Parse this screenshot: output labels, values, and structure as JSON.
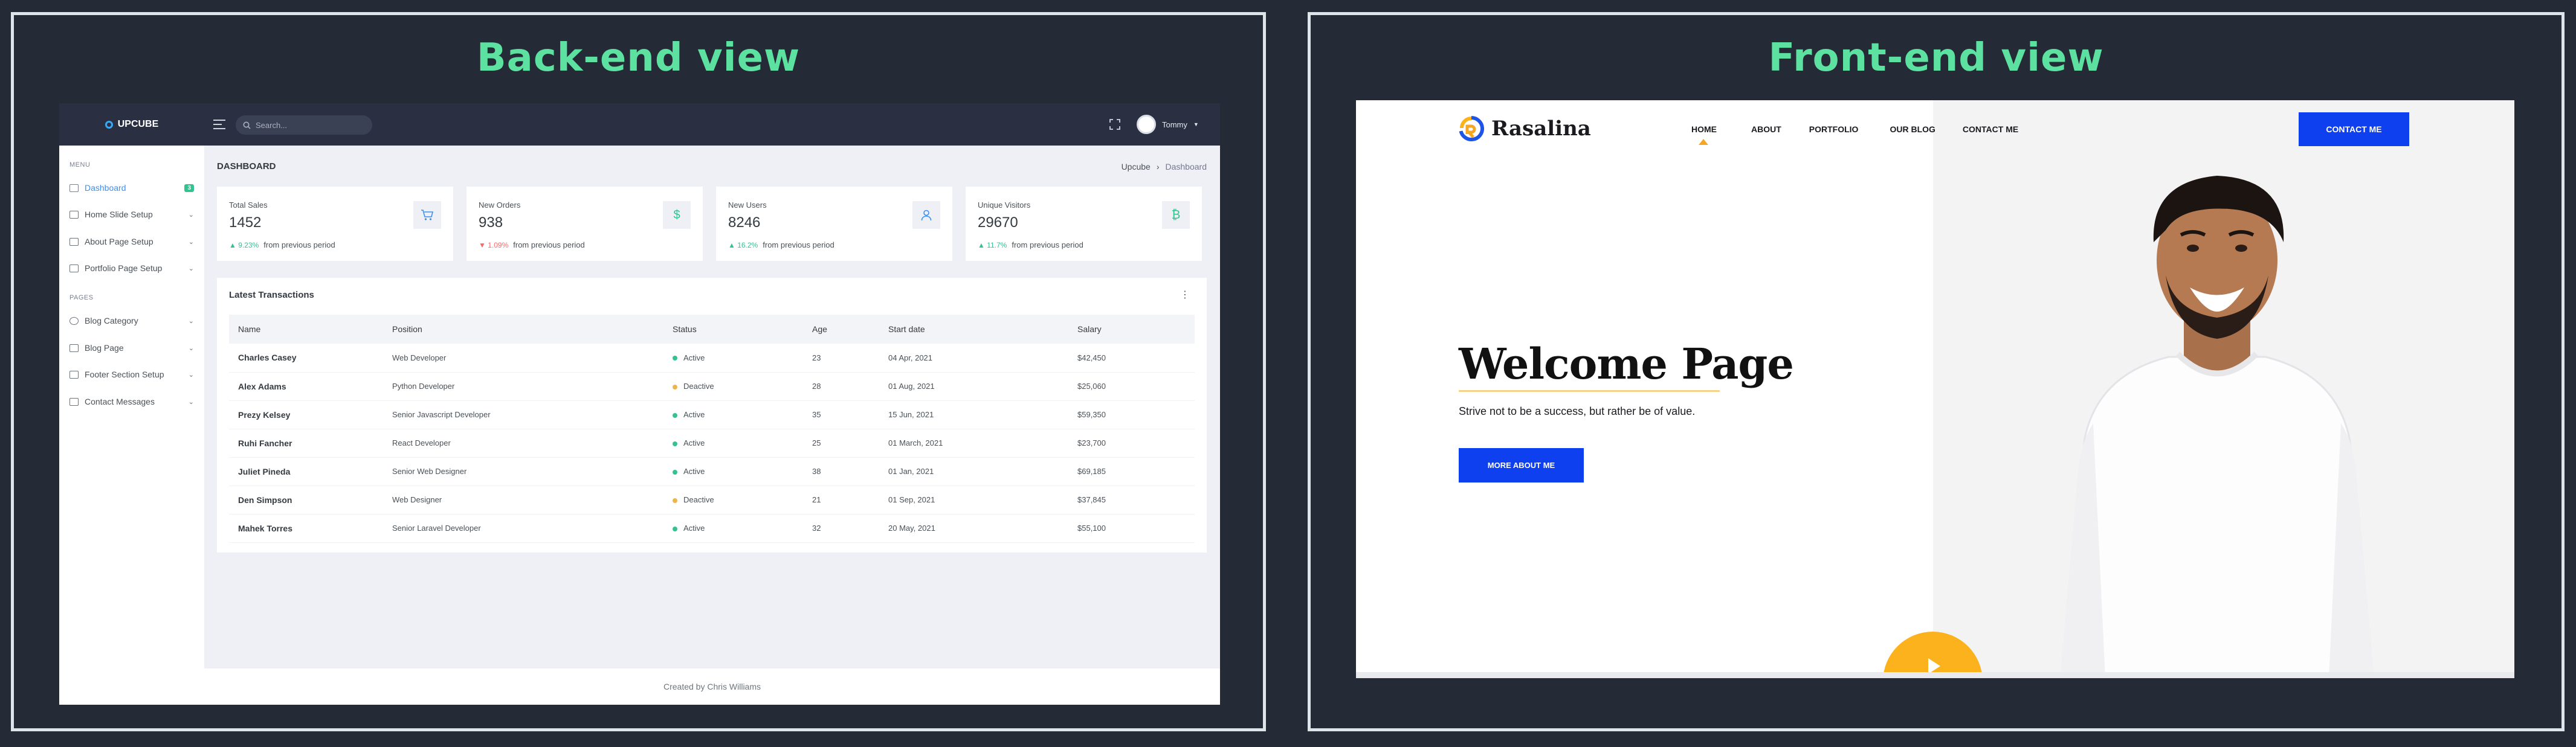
{
  "panels": {
    "back_title": "Back-end view",
    "front_title": "Front-end view"
  },
  "admin": {
    "brand": "UPCUBE",
    "search_placeholder": "Search...",
    "user_name": "Tommy",
    "sidebar": {
      "menu_heading": "MENU",
      "pages_heading": "PAGES",
      "dashboard_label": "Dashboard",
      "dashboard_badge": "3",
      "items": [
        {
          "label": "Home Slide Setup"
        },
        {
          "label": "About Page Setup"
        },
        {
          "label": "Portfolio Page Setup"
        },
        {
          "label": "Blog Category"
        },
        {
          "label": "Blog Page"
        },
        {
          "label": "Footer Section Setup"
        },
        {
          "label": "Contact Messages"
        }
      ]
    },
    "page_title": "DASHBOARD",
    "breadcrumb": {
      "root": "Upcube",
      "current": "Dashboard"
    },
    "stats": [
      {
        "label": "Total Sales",
        "value": "1452",
        "pct": "9.23%",
        "trend": "up",
        "suffix": "from previous period",
        "icon": "cart-icon"
      },
      {
        "label": "New Orders",
        "value": "938",
        "pct": "1.09%",
        "trend": "down",
        "suffix": "from previous period",
        "icon": "dollar-icon"
      },
      {
        "label": "New Users",
        "value": "8246",
        "pct": "16.2%",
        "trend": "up",
        "suffix": "from previous period",
        "icon": "user-icon"
      },
      {
        "label": "Unique Visitors",
        "value": "29670",
        "pct": "11.7%",
        "trend": "up",
        "suffix": "from previous period",
        "icon": "bitcoin-icon"
      }
    ],
    "transactions": {
      "title": "Latest Transactions",
      "columns": [
        "Name",
        "Position",
        "Status",
        "Age",
        "Start date",
        "Salary"
      ],
      "rows": [
        {
          "name": "Charles Casey",
          "position": "Web Developer",
          "status": "Active",
          "age": "23",
          "start": "04 Apr, 2021",
          "salary": "$42,450"
        },
        {
          "name": "Alex Adams",
          "position": "Python Developer",
          "status": "Deactive",
          "age": "28",
          "start": "01 Aug, 2021",
          "salary": "$25,060"
        },
        {
          "name": "Prezy Kelsey",
          "position": "Senior Javascript Developer",
          "status": "Active",
          "age": "35",
          "start": "15 Jun, 2021",
          "salary": "$59,350"
        },
        {
          "name": "Ruhi Fancher",
          "position": "React Developer",
          "status": "Active",
          "age": "25",
          "start": "01 March, 2021",
          "salary": "$23,700"
        },
        {
          "name": "Juliet Pineda",
          "position": "Senior Web Designer",
          "status": "Active",
          "age": "38",
          "start": "01 Jan, 2021",
          "salary": "$69,185"
        },
        {
          "name": "Den Simpson",
          "position": "Web Designer",
          "status": "Deactive",
          "age": "21",
          "start": "01 Sep, 2021",
          "salary": "$37,845"
        },
        {
          "name": "Mahek Torres",
          "position": "Senior Laravel Developer",
          "status": "Active",
          "age": "32",
          "start": "20 May, 2021",
          "salary": "$55,100"
        }
      ]
    },
    "footer": "Created by Chris Williams",
    "colors": {
      "active": "#34c38f",
      "deactive": "#f1b44c",
      "accent": "#3b8ff0"
    }
  },
  "site": {
    "brand": "Rasalina",
    "nav": [
      "HOME",
      "ABOUT",
      "PORTFOLIO",
      "OUR BLOG",
      "CONTACT ME"
    ],
    "contact_button": "CONTACT ME",
    "hero_title": "Welcome Page",
    "hero_subtitle": "Strive not to be a success, but rather be of value.",
    "hero_button": "MORE ABOUT ME",
    "colors": {
      "primary": "#0e40f0",
      "accent": "#fbb21d"
    }
  }
}
